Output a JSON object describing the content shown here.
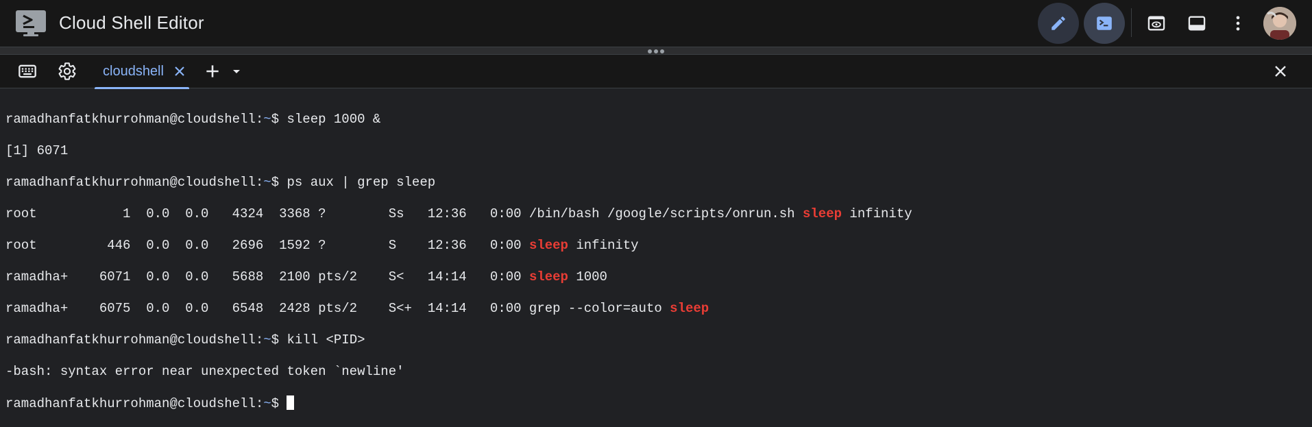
{
  "header": {
    "title": "Cloud Shell Editor",
    "icons": {
      "logo": "cloud-shell-terminal-icon",
      "editor": "pencil-icon",
      "terminal": "terminal-icon",
      "preview": "web-preview-icon",
      "layout": "panel-layout-icon",
      "more": "more-vert-icon"
    },
    "accent_color": "#8ab4f8"
  },
  "tabbar": {
    "tab_label": "cloudshell",
    "icons": [
      "keyboard-icon",
      "gear-icon",
      "close-icon",
      "plus-icon",
      "chevron-down-icon"
    ]
  },
  "terminal": {
    "prompt_user": "ramadhanfatkhurrohman@cloudshell:",
    "prompt_path": "~",
    "prompt_symbol": "$ ",
    "highlight_color": "#ea3d35",
    "lines": {
      "cmd1": "sleep 1000 &",
      "out1": "[1] 6071",
      "cmd2": "ps aux | grep sleep",
      "ps1_prefix": "root           1  0.0  0.0   4324  3368 ?        Ss   12:36   0:00 /bin/bash /google/scripts/onrun.sh ",
      "ps1_hl": "sleep",
      "ps1_suffix": " infinity",
      "ps2_prefix": "root         446  0.0  0.0   2696  1592 ?        S    12:36   0:00 ",
      "ps2_hl": "sleep",
      "ps2_suffix": " infinity",
      "ps3_prefix": "ramadha+    6071  0.0  0.0   5688  2100 pts/2    S<   14:14   0:00 ",
      "ps3_hl": "sleep",
      "ps3_suffix": " 1000",
      "ps4_prefix": "ramadha+    6075  0.0  0.0   6548  2428 pts/2    S<+  14:14   0:00 grep --color=auto ",
      "ps4_hl": "sleep",
      "cmd3": "kill <PID>",
      "err1": "-bash: syntax error near unexpected token `newline'"
    }
  }
}
